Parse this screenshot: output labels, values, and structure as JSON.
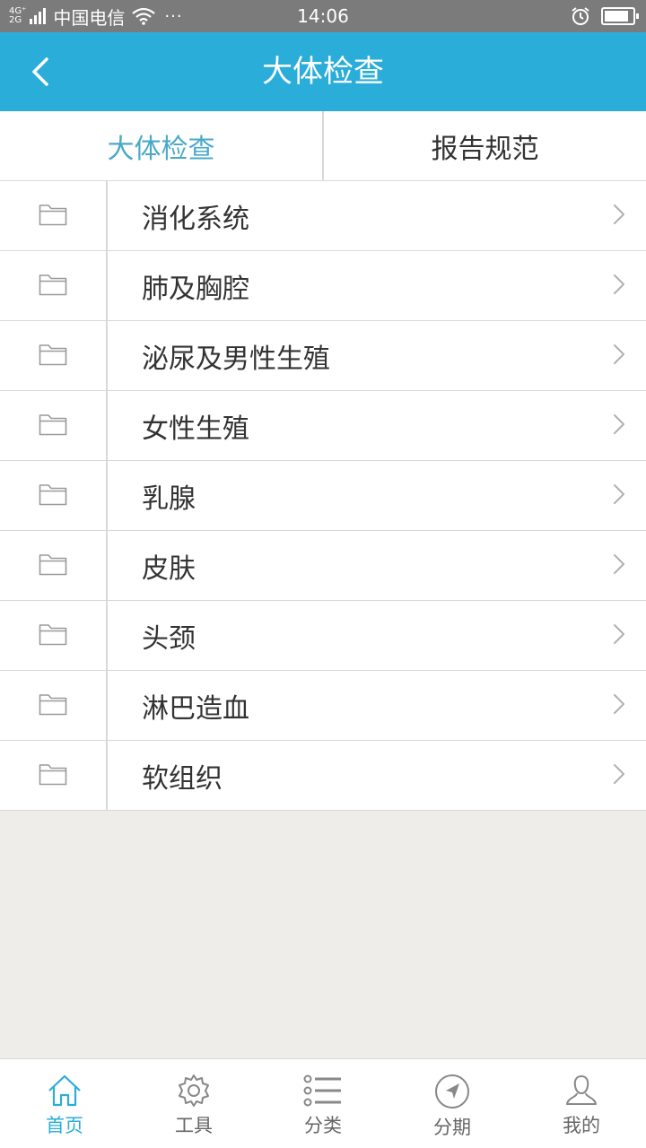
{
  "status_bar": {
    "network": "4G⁺\n2G",
    "carrier": "中国电信",
    "more": "···",
    "time": "14:06",
    "battery_level": 0.85
  },
  "header": {
    "title": "大体检查",
    "back_icon": "chevron-left-icon"
  },
  "tabs": [
    {
      "label": "大体检查",
      "active": true
    },
    {
      "label": "报告规范",
      "active": false
    }
  ],
  "list": {
    "items": [
      {
        "label": "消化系统",
        "icon": "folder-icon"
      },
      {
        "label": "肺及胸腔",
        "icon": "folder-icon"
      },
      {
        "label": "泌尿及男性生殖",
        "icon": "folder-icon"
      },
      {
        "label": "女性生殖",
        "icon": "folder-icon"
      },
      {
        "label": "乳腺",
        "icon": "folder-icon"
      },
      {
        "label": "皮肤",
        "icon": "folder-icon"
      },
      {
        "label": "头颈",
        "icon": "folder-icon"
      },
      {
        "label": "淋巴造血",
        "icon": "folder-icon"
      },
      {
        "label": "软组织",
        "icon": "folder-icon"
      }
    ]
  },
  "bottom_nav": [
    {
      "label": "首页",
      "icon": "home-icon",
      "active": true
    },
    {
      "label": "工具",
      "icon": "gear-icon",
      "active": false
    },
    {
      "label": "分类",
      "icon": "list-icon",
      "active": false
    },
    {
      "label": "分期",
      "icon": "compass-icon",
      "active": false
    },
    {
      "label": "我的",
      "icon": "user-icon",
      "active": false
    }
  ],
  "colors": {
    "primary": "#2aadd8",
    "active_tab": "#4aa9c9",
    "background": "#efedea",
    "status_bar": "#7b7b7b"
  }
}
